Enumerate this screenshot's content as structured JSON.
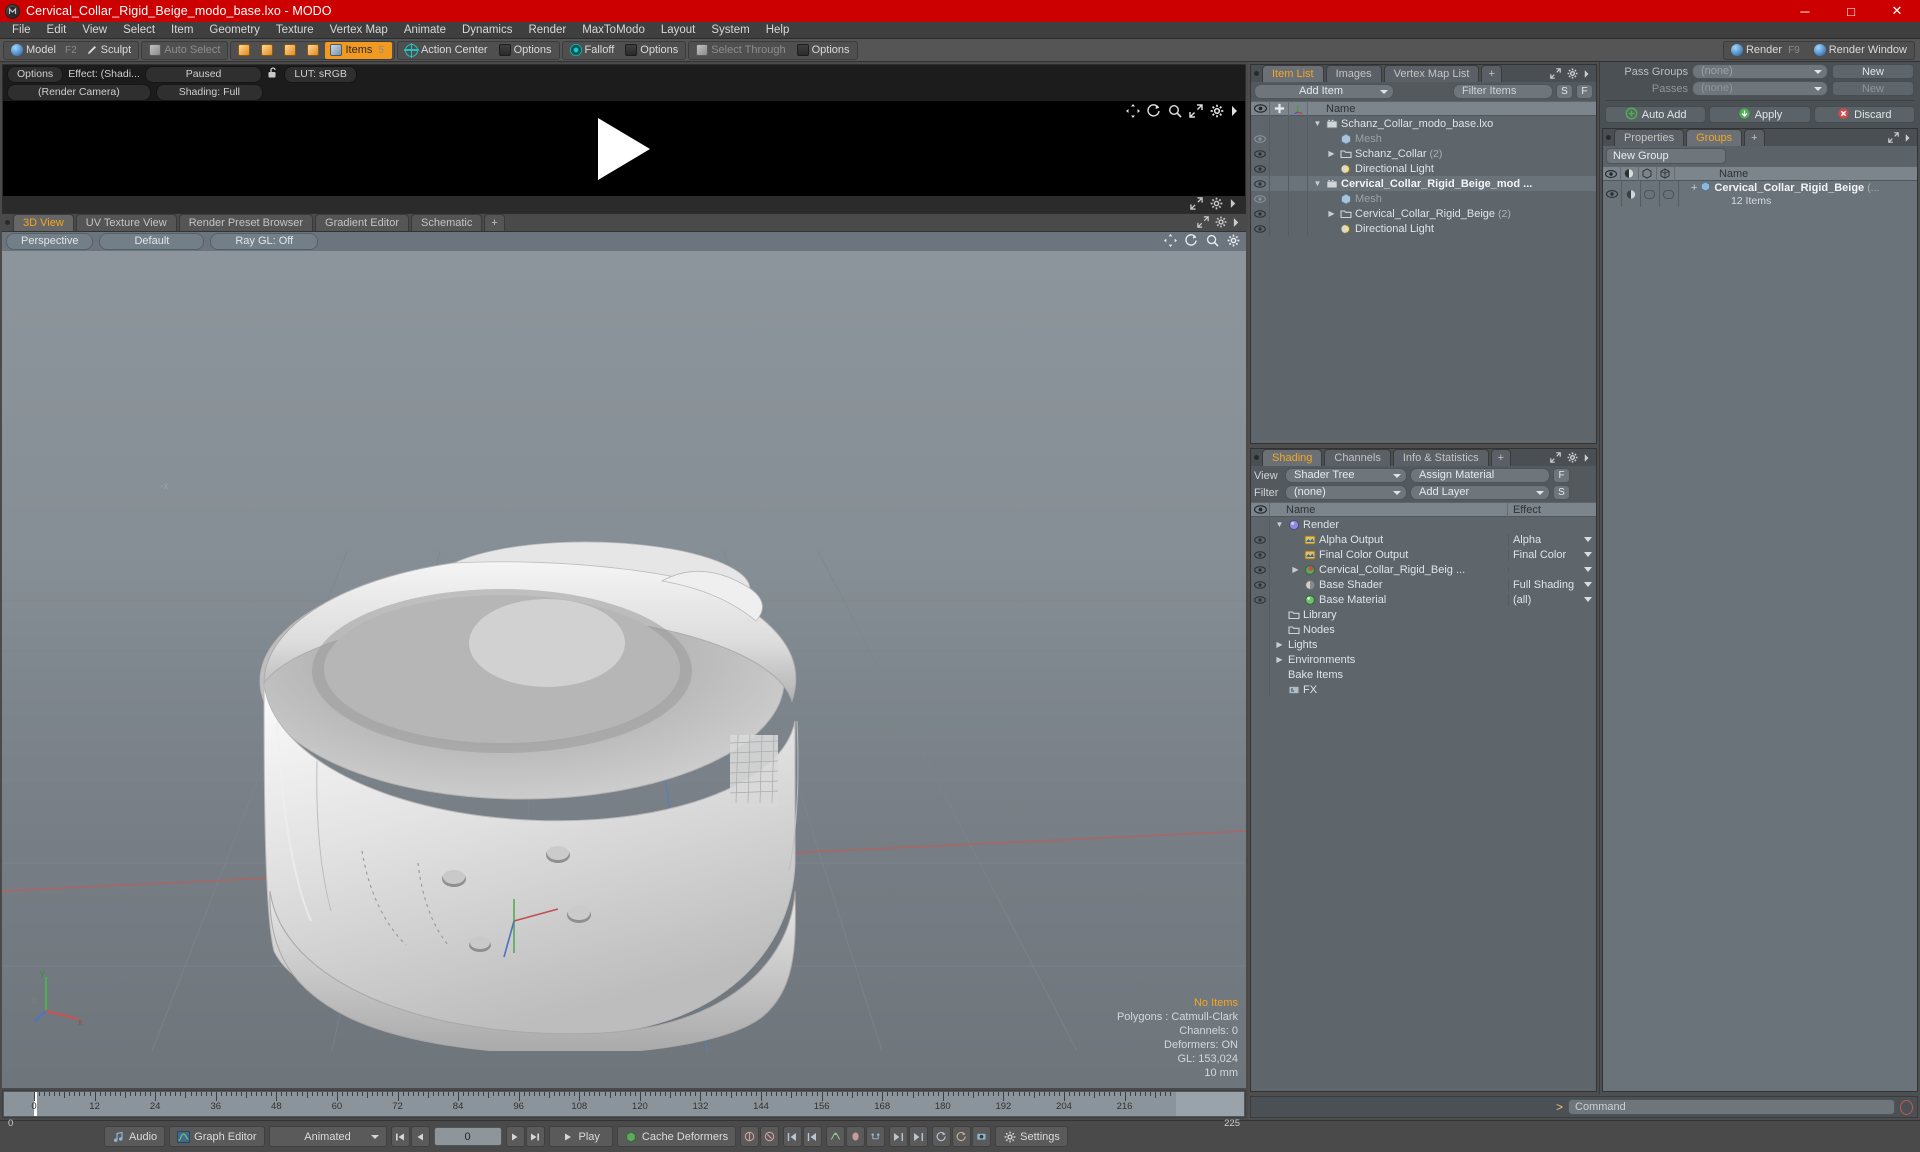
{
  "window": {
    "title": "Cervical_Collar_Rigid_Beige_modo_base.lxo - MODO",
    "app_icon": "modo-logo-icon",
    "minimize": "─",
    "maximize": "□",
    "close": "✕",
    "titlebar_color": "#cc0000"
  },
  "menubar": {
    "items": [
      {
        "label": "File"
      },
      {
        "label": "Edit"
      },
      {
        "label": "View"
      },
      {
        "label": "Select"
      },
      {
        "label": "Item"
      },
      {
        "label": "Geometry"
      },
      {
        "label": "Texture"
      },
      {
        "label": "Vertex Map"
      },
      {
        "label": "Animate"
      },
      {
        "label": "Dynamics"
      },
      {
        "label": "Render"
      },
      {
        "label": "MaxToModo"
      },
      {
        "label": "Layout"
      },
      {
        "label": "System"
      },
      {
        "label": "Help"
      }
    ]
  },
  "modebar": {
    "model": "Model",
    "model_key": "F2",
    "sculpt": "Sculpt",
    "auto_select": "Auto Select",
    "items": "Items",
    "items_key": "5",
    "action_center": "Action Center",
    "options_1": "Options",
    "falloff": "Falloff",
    "options_2": "Options",
    "select_through": "Select Through",
    "options_3": "Options",
    "render": "Render",
    "render_key": "F9",
    "render_window": "Render Window"
  },
  "render_pane": {
    "options": "Options",
    "effect": "Effect: (Shadi...",
    "paused": "Paused",
    "lock_icon": "unlock-icon",
    "lut": "LUT: sRGB",
    "camera": "(Render Camera)",
    "shading": "Shading: Full"
  },
  "view3d": {
    "tabs": [
      {
        "label": "3D View",
        "selected": true
      },
      {
        "label": "UV Texture View",
        "selected": false
      },
      {
        "label": "Render Preset Browser",
        "selected": false
      },
      {
        "label": "Gradient Editor",
        "selected": false
      },
      {
        "label": "Schematic",
        "selected": false
      },
      {
        "label": "+",
        "selected": false
      }
    ],
    "toolbar": {
      "perspective": "Perspective",
      "default": "Default",
      "raygl": "Ray GL: Off"
    },
    "info": {
      "no_items": "No Items",
      "polygons": "Polygons : Catmull-Clark",
      "channels": "Channels: 0",
      "deformers": "Deformers: ON",
      "gl": "GL: 153,024",
      "scale": "10 mm"
    },
    "axis": {
      "x": "x",
      "y": "y",
      "z": "z"
    }
  },
  "timeline": {
    "ticks": [
      0,
      12,
      24,
      36,
      48,
      60,
      72,
      84,
      96,
      108,
      120,
      132,
      144,
      156,
      168,
      180,
      192,
      204,
      216
    ],
    "start": "0",
    "end": "225",
    "range_end": "225",
    "playhead": "0"
  },
  "item_list": {
    "tabs": [
      {
        "label": "Item List",
        "selected": true
      },
      {
        "label": "Images",
        "selected": false
      },
      {
        "label": "Vertex Map List",
        "selected": false
      },
      {
        "label": "+",
        "selected": false
      }
    ],
    "add_item": "Add Item",
    "filter_items": "Filter Items",
    "btn_s": "S",
    "btn_f": "F",
    "col_name": "Name",
    "col_eye": "visibility-icon",
    "col_lock": "lock-icon",
    "col_axis": "axis-icon",
    "rows": [
      {
        "name": "Schanz_Collar_modo_base.lxo",
        "icon": "scene-icon",
        "indent": 1,
        "twist": "▼",
        "bold": false,
        "eye": false,
        "dim": false,
        "count": ""
      },
      {
        "name": "Mesh",
        "icon": "mesh-icon",
        "indent": 2,
        "twist": "",
        "bold": false,
        "eye": true,
        "dim": true,
        "count": ""
      },
      {
        "name": "Schanz_Collar",
        "icon": "folder-icon",
        "indent": 2,
        "twist": "▶",
        "bold": false,
        "eye": true,
        "dim": false,
        "count": "(2)"
      },
      {
        "name": "Directional Light",
        "icon": "light-icon",
        "indent": 2,
        "twist": "",
        "bold": false,
        "eye": true,
        "dim": false,
        "count": ""
      },
      {
        "name": "Cervical_Collar_Rigid_Beige_mod ...",
        "icon": "scene-icon",
        "indent": 1,
        "twist": "▼",
        "bold": true,
        "eye": true,
        "dim": false,
        "count": ""
      },
      {
        "name": "Mesh",
        "icon": "mesh-icon",
        "indent": 2,
        "twist": "",
        "bold": false,
        "eye": true,
        "dim": true,
        "count": ""
      },
      {
        "name": "Cervical_Collar_Rigid_Beige",
        "icon": "folder-icon",
        "indent": 2,
        "twist": "▶",
        "bold": false,
        "eye": true,
        "dim": false,
        "count": "(2)"
      },
      {
        "name": "Directional Light",
        "icon": "light-icon",
        "indent": 2,
        "twist": "",
        "bold": false,
        "eye": true,
        "dim": false,
        "count": ""
      }
    ]
  },
  "shading": {
    "tabs": [
      {
        "label": "Shading",
        "selected": true
      },
      {
        "label": "Channels",
        "selected": false
      },
      {
        "label": "Info & Statistics",
        "selected": false
      },
      {
        "label": "+",
        "selected": false
      }
    ],
    "view_label": "View",
    "view_value": "Shader Tree",
    "assign_material": "Assign Material",
    "btn_f": "F",
    "filter_label": "Filter",
    "filter_value": "(none)",
    "add_layer": "Add Layer",
    "btn_s": "S",
    "col_name": "Name",
    "col_effect": "Effect",
    "rows": [
      {
        "name": "Render",
        "icon": "render-sphere-icon",
        "indent": 1,
        "twist": "▼",
        "eye": false,
        "effect": "",
        "caret": false
      },
      {
        "name": "Alpha Output",
        "icon": "output-icon",
        "indent": 2,
        "twist": "",
        "eye": true,
        "effect": "Alpha",
        "caret": true
      },
      {
        "name": "Final Color Output",
        "icon": "output-icon",
        "indent": 2,
        "twist": "",
        "eye": true,
        "effect": "Final Color",
        "caret": true
      },
      {
        "name": "Cervical_Collar_Rigid_Beig ...",
        "icon": "material-red-icon",
        "indent": 2,
        "twist": "▶",
        "eye": true,
        "effect": "",
        "caret": true
      },
      {
        "name": "Base Shader",
        "icon": "shader-icon",
        "indent": 2,
        "twist": "",
        "eye": true,
        "effect": "Full Shading",
        "caret": true
      },
      {
        "name": "Base Material",
        "icon": "material-green-icon",
        "indent": 2,
        "twist": "",
        "eye": true,
        "effect": "(all)",
        "caret": true
      },
      {
        "name": "Library",
        "icon": "folder-icon",
        "indent": 1,
        "twist": "",
        "eye": false,
        "effect": "",
        "caret": false
      },
      {
        "name": "Nodes",
        "icon": "folder-icon",
        "indent": 1,
        "twist": "",
        "eye": false,
        "effect": "",
        "caret": false
      },
      {
        "name": "Lights",
        "icon": "",
        "indent": 1,
        "twist": "▶",
        "eye": false,
        "effect": "",
        "caret": false
      },
      {
        "name": "Environments",
        "icon": "",
        "indent": 1,
        "twist": "▶",
        "eye": false,
        "effect": "",
        "caret": false
      },
      {
        "name": "Bake Items",
        "icon": "",
        "indent": 1,
        "twist": "",
        "eye": false,
        "effect": "",
        "caret": false
      },
      {
        "name": "FX",
        "icon": "fx-icon",
        "indent": 1,
        "twist": "",
        "eye": false,
        "effect": "",
        "caret": false
      }
    ]
  },
  "passes": {
    "pass_groups_label": "Pass Groups",
    "pass_groups_value": "(none)",
    "pass_groups_new": "New",
    "passes_label": "Passes",
    "passes_value": "(none)",
    "passes_new": "New",
    "auto_add": "Auto Add",
    "apply": "Apply",
    "discard": "Discard"
  },
  "groups": {
    "tabs": [
      {
        "label": "Properties",
        "selected": false
      },
      {
        "label": "Groups",
        "selected": true
      },
      {
        "label": "+",
        "selected": false
      }
    ],
    "new_group": "New Group",
    "col_name": "Name",
    "row_name": "Cervical_Collar_Rigid_Beige",
    "row_suffix": "(...",
    "row_count": "12 Items"
  },
  "command_bar": {
    "prompt": ">",
    "placeholder": "Command",
    "record_icon": "record-icon"
  },
  "bottombar": {
    "audio": "Audio",
    "graph_editor": "Graph Editor",
    "animated": "Animated",
    "frame": "0",
    "play": "Play",
    "cache_deformers": "Cache Deformers",
    "settings": "Settings",
    "transport": {
      "first": "⏮",
      "prev": "◀",
      "next": "▶",
      "last": "⏭"
    }
  }
}
